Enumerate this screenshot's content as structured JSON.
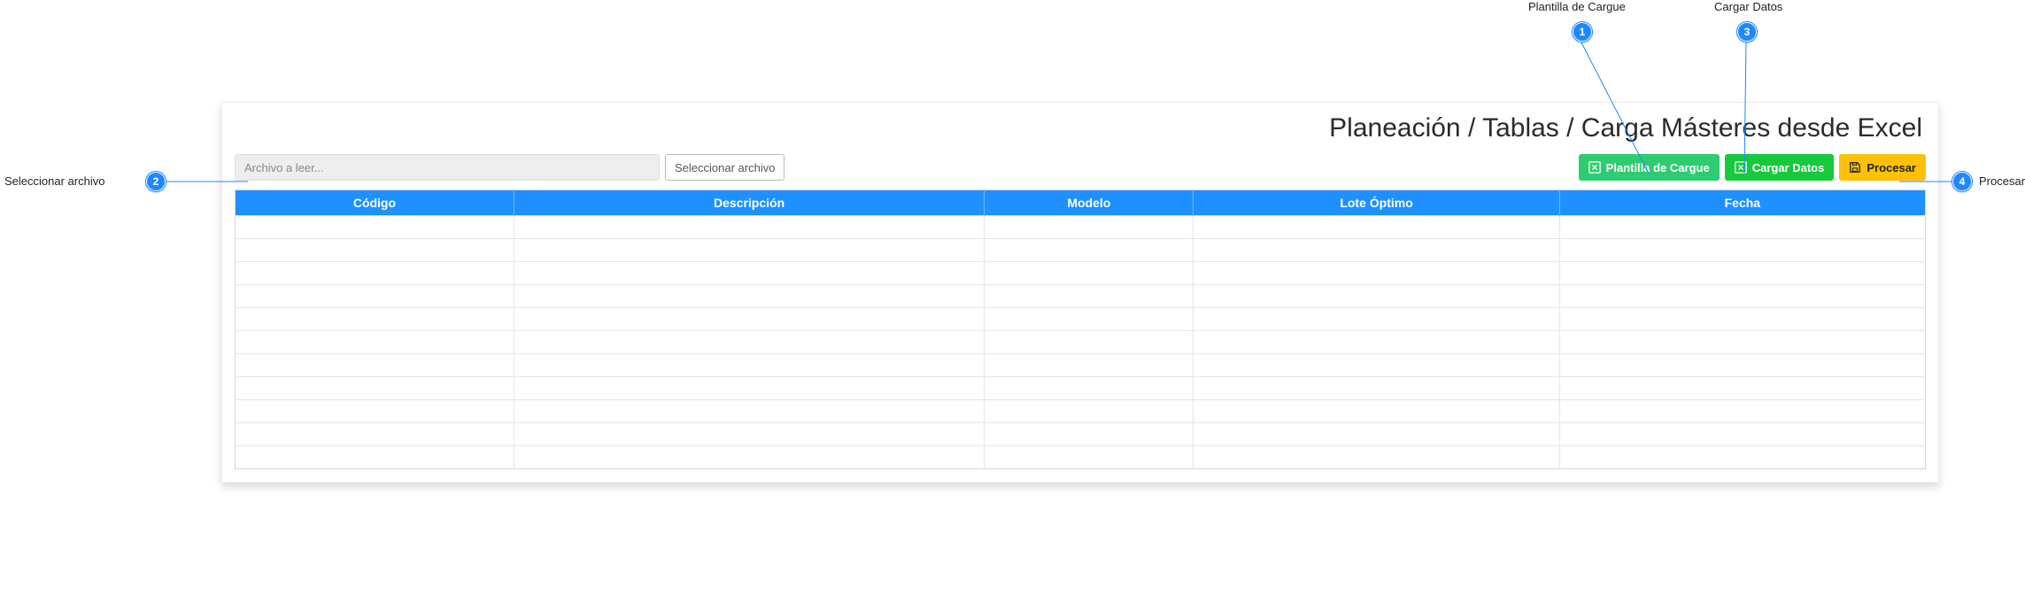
{
  "breadcrumb": "Planeación / Tablas / Carga Másteres desde Excel",
  "file_input": {
    "placeholder": "Archivo a leer..."
  },
  "buttons": {
    "select_file": "Seleccionar archivo",
    "template": "Plantilla de Cargue",
    "load": "Cargar Datos",
    "process": "Procesar"
  },
  "table": {
    "columns": [
      "Código",
      "Descripción",
      "Modelo",
      "Lote Óptimo",
      "Fecha"
    ],
    "col_widths_pct": [
      16,
      27,
      12,
      21,
      21
    ],
    "empty_rows": 11
  },
  "callouts": {
    "1": {
      "label": "Plantilla de Cargue"
    },
    "2": {
      "label": "Seleccionar archivo"
    },
    "3": {
      "label": "Cargar Datos"
    },
    "4": {
      "label": "Procesar"
    }
  }
}
